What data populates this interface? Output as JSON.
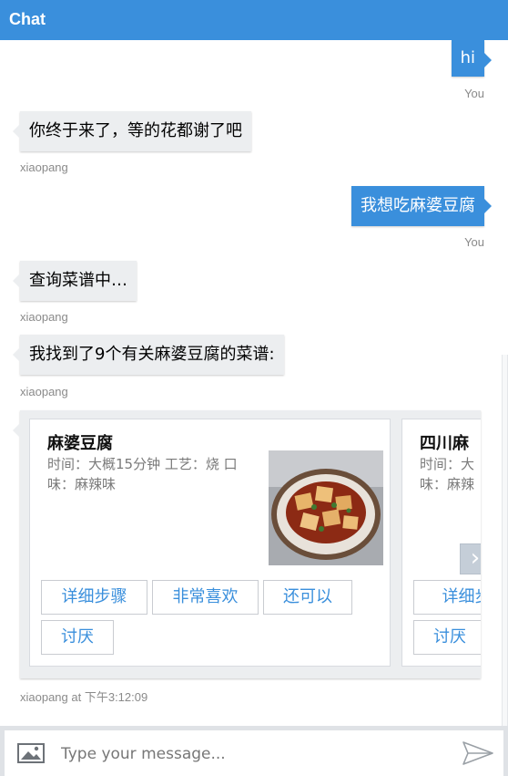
{
  "header": {
    "title": "Chat"
  },
  "messages": [
    {
      "sender": "You",
      "text": "hi"
    },
    {
      "sender": "xiaopang",
      "text": "你终于来了，等的花都谢了吧"
    },
    {
      "sender": "You",
      "text": "我想吃麻婆豆腐"
    },
    {
      "sender": "xiaopang",
      "text": "查询菜谱中…"
    },
    {
      "sender": "xiaopang",
      "text": "我找到了9个有关麻婆豆腐的菜谱:"
    }
  ],
  "carousel": {
    "sender_time": "xiaopang at 下午3:12:09",
    "cards": [
      {
        "title": "麻婆豆腐",
        "desc": "时间：大概15分钟 工艺：烧 口味：麻辣味",
        "buttons": [
          "详细步骤",
          "非常喜欢",
          "还可以",
          "讨厌"
        ]
      },
      {
        "title": "四川麻",
        "desc": "时间：大 味：麻辣",
        "buttons": [
          "详细步",
          "讨厌"
        ]
      }
    ],
    "next_icon": "chevron-right-icon"
  },
  "composer": {
    "placeholder": "Type your message...",
    "image_icon": "image-icon",
    "send_icon": "send-icon"
  },
  "colors": {
    "accent": "#3a8fdc",
    "bot_bubble": "#eceef0"
  }
}
